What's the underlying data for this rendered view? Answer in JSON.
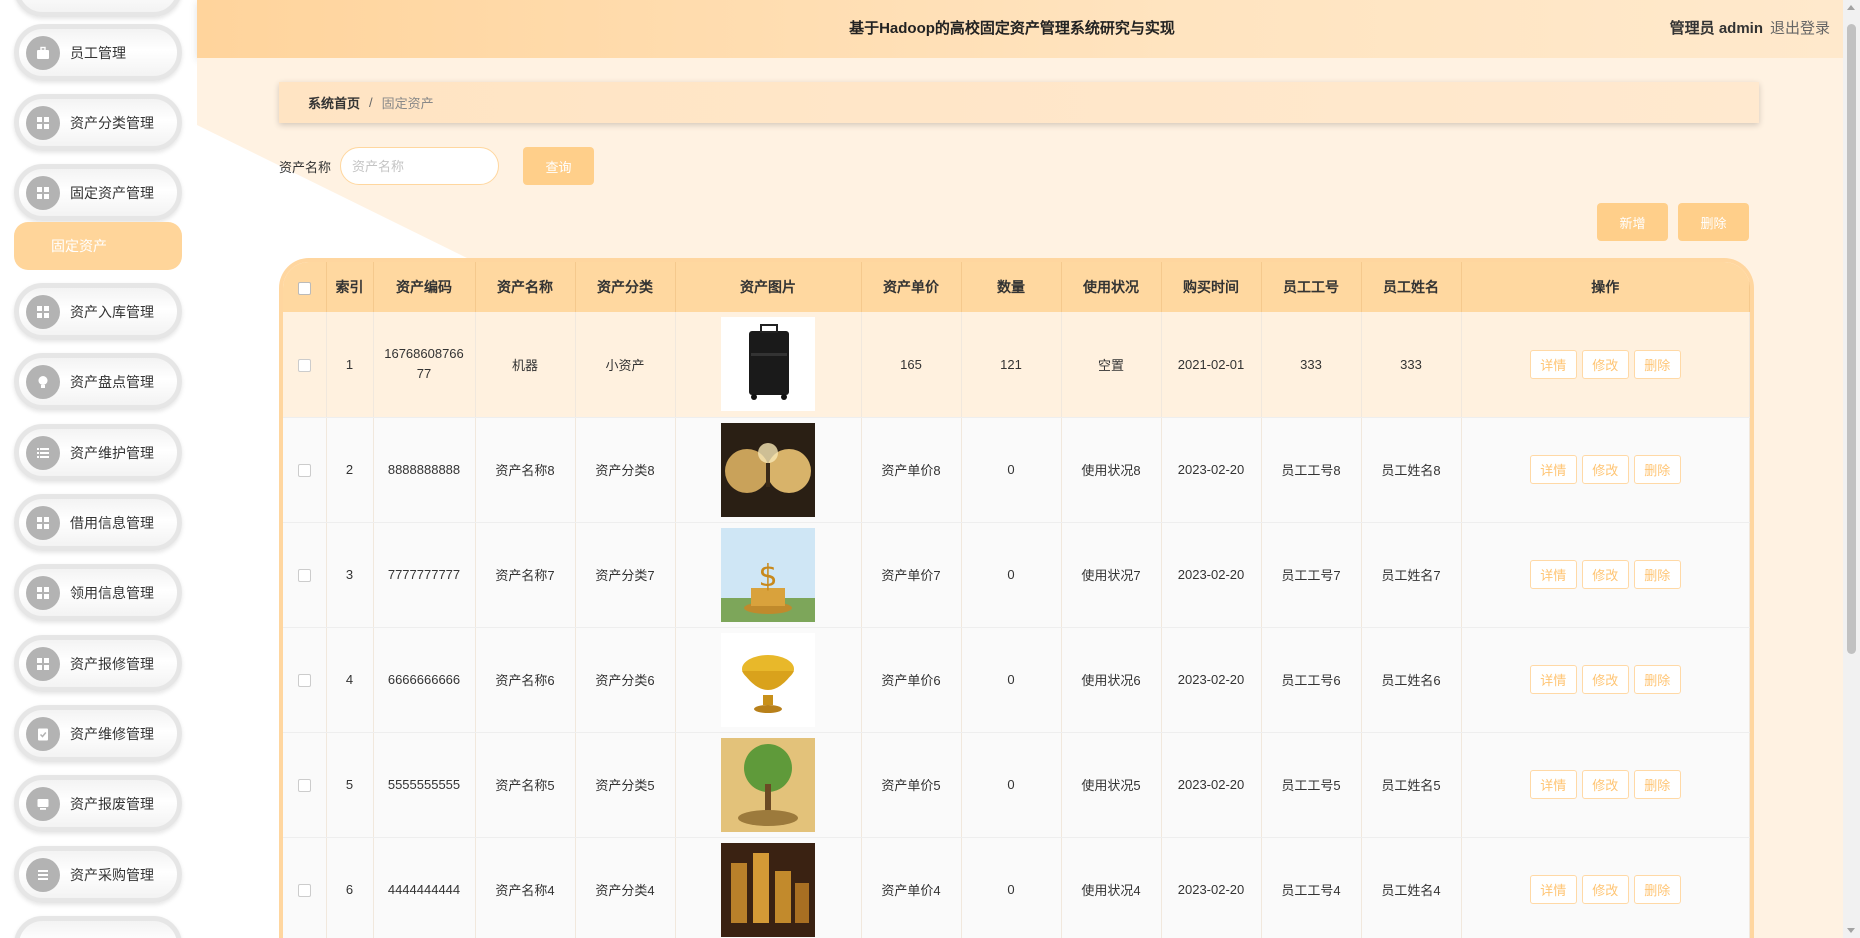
{
  "header": {
    "title": "基于Hadoop的高校固定资产管理系统研究与实现",
    "user": "管理员 admin",
    "logout": "退出登录"
  },
  "sidebar": {
    "items": [
      {
        "label": "员工管理",
        "icon": "briefcase-icon"
      },
      {
        "label": "资产分类管理",
        "icon": "grid-icon"
      },
      {
        "label": "固定资产管理",
        "icon": "grid-icon"
      },
      {
        "label": "资产入库管理",
        "icon": "grid-icon"
      },
      {
        "label": "资产盘点管理",
        "icon": "bulb-icon"
      },
      {
        "label": "资产维护管理",
        "icon": "list-icon"
      },
      {
        "label": "借用信息管理",
        "icon": "grid-icon"
      },
      {
        "label": "领用信息管理",
        "icon": "grid-icon"
      },
      {
        "label": "资产报修管理",
        "icon": "grid-icon"
      },
      {
        "label": "资产维修管理",
        "icon": "clipboard-icon"
      },
      {
        "label": "资产报废管理",
        "icon": "monitor-icon"
      },
      {
        "label": "资产采购管理",
        "icon": "list-icon"
      }
    ],
    "active_sub": "固定资产"
  },
  "breadcrumb": {
    "home": "系统首页",
    "separator": "/",
    "current": "固定资产"
  },
  "search": {
    "label": "资产名称",
    "placeholder": "资产名称",
    "button": "查询"
  },
  "actions": {
    "add": "新增",
    "delete": "删除"
  },
  "table": {
    "columns": [
      "索引",
      "资产编码",
      "资产名称",
      "资产分类",
      "资产图片",
      "资产单价",
      "数量",
      "使用状况",
      "购买时间",
      "员工工号",
      "员工姓名",
      "操作"
    ],
    "row_actions": [
      "详情",
      "修改",
      "删除"
    ],
    "rows": [
      {
        "index": "1",
        "code": "1676860876677",
        "name": "机器",
        "category": "小资产",
        "image": "black-suitcase",
        "price": "165",
        "qty": "121",
        "status": "空置",
        "date": "2021-02-01",
        "emp_no": "333",
        "emp_name": "333"
      },
      {
        "index": "2",
        "code": "8888888888",
        "name": "资产名称8",
        "category": "资产分类8",
        "image": "gold-coins-dark",
        "price": "资产单价8",
        "qty": "0",
        "status": "使用状况8",
        "date": "2023-02-20",
        "emp_no": "员工工号8",
        "emp_name": "员工姓名8"
      },
      {
        "index": "3",
        "code": "7777777777",
        "name": "资产名称7",
        "category": "资产分类7",
        "image": "dollar-coins-sky",
        "price": "资产单价7",
        "qty": "0",
        "status": "使用状况7",
        "date": "2023-02-20",
        "emp_no": "员工工号7",
        "emp_name": "员工姓名7"
      },
      {
        "index": "4",
        "code": "6666666666",
        "name": "资产名称6",
        "category": "资产分类6",
        "image": "golden-bowl",
        "price": "资产单价6",
        "qty": "0",
        "status": "使用状况6",
        "date": "2023-02-20",
        "emp_no": "员工工号6",
        "emp_name": "员工姓名6"
      },
      {
        "index": "5",
        "code": "5555555555",
        "name": "资产名称5",
        "category": "资产分类5",
        "image": "money-tree",
        "price": "资产单价5",
        "qty": "0",
        "status": "使用状况5",
        "date": "2023-02-20",
        "emp_no": "员工工号5",
        "emp_name": "员工姓名5"
      },
      {
        "index": "6",
        "code": "4444444444",
        "name": "资产名称4",
        "category": "资产分类4",
        "image": "coin-stacks",
        "price": "资产单价4",
        "qty": "0",
        "status": "使用状况4",
        "date": "2023-02-20",
        "emp_no": "员工工号4",
        "emp_name": "员工姓名4"
      }
    ]
  },
  "colors": {
    "accent": "#ffcf8a",
    "header": "#ffd49c",
    "background": "#fff2e2"
  }
}
